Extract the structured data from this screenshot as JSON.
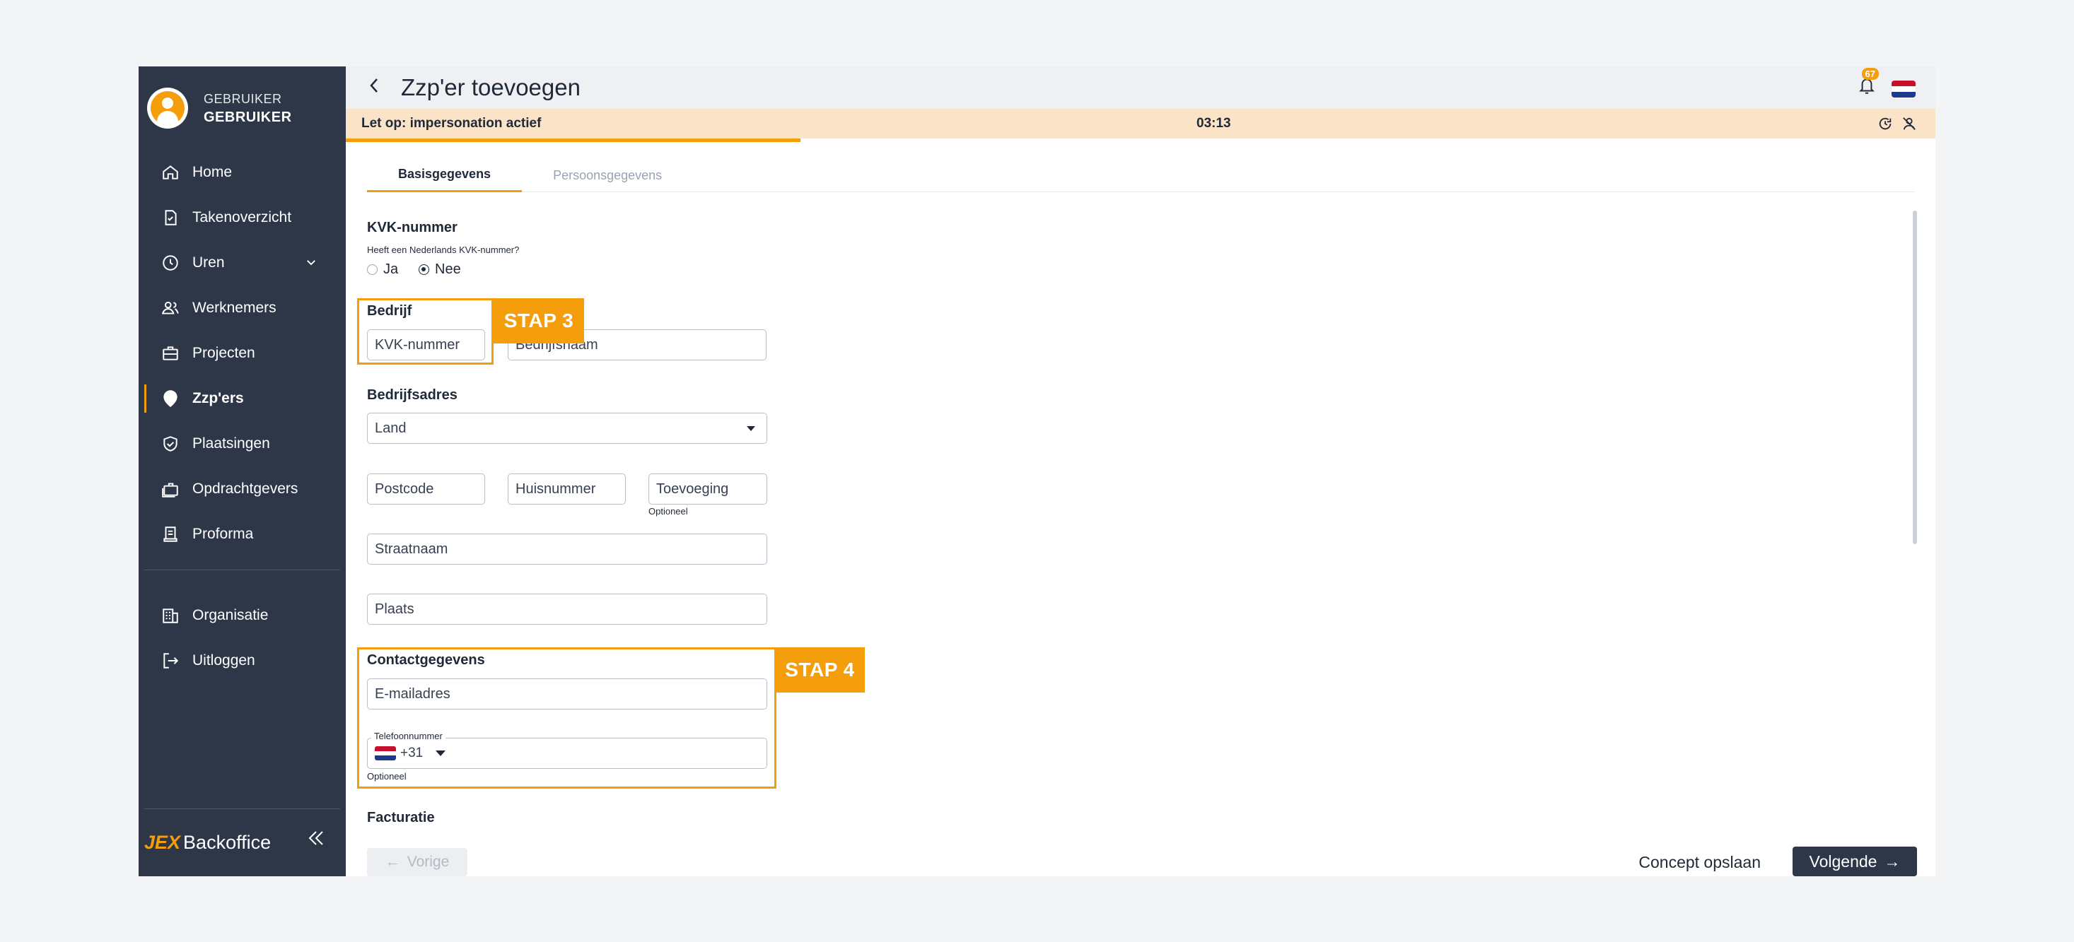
{
  "user": {
    "role": "GEBRUIKER",
    "name": "GEBRUIKER"
  },
  "nav": {
    "items": [
      {
        "label": "Home",
        "icon": "home-icon"
      },
      {
        "label": "Takenoverzicht",
        "icon": "task-icon"
      },
      {
        "label": "Uren",
        "icon": "clock-icon"
      },
      {
        "label": "Werknemers",
        "icon": "people-icon"
      },
      {
        "label": "Projecten",
        "icon": "briefcase-icon"
      },
      {
        "label": "Zzp'ers",
        "icon": "person-pin-icon"
      },
      {
        "label": "Plaatsingen",
        "icon": "shield-check-icon"
      },
      {
        "label": "Opdrachtgevers",
        "icon": "client-icon"
      },
      {
        "label": "Proforma",
        "icon": "document-icon"
      }
    ],
    "bottom": [
      {
        "label": "Organisatie",
        "icon": "building-icon"
      },
      {
        "label": "Uitloggen",
        "icon": "logout-icon"
      }
    ]
  },
  "brand": {
    "jex": "JEX",
    "name": "Backoffice"
  },
  "header": {
    "title": "Zzp'er toevoegen",
    "notifications": "67"
  },
  "impersonation": {
    "label": "Let op: impersonation actief",
    "timer": "03:13",
    "progress": 0.286
  },
  "tabs": [
    {
      "label": "Basisgegevens"
    },
    {
      "label": "Persoonsgegevens"
    }
  ],
  "form": {
    "kvk": {
      "heading": "KVK-nummer",
      "question": "Heeft een Nederlands KVK-nummer?",
      "options": [
        "Ja",
        "Nee"
      ],
      "selected": "Nee"
    },
    "bedrijf": {
      "heading": "Bedrijf",
      "kvk_placeholder": "KVK-nummer",
      "name_placeholder": "Bedrijfsnaam"
    },
    "adres": {
      "heading": "Bedrijfsadres",
      "land": "Land",
      "postcode": "Postcode",
      "huisnummer": "Huisnummer",
      "toevoeging": "Toevoeging",
      "optioneel": "Optioneel",
      "straatnaam": "Straatnaam",
      "plaats": "Plaats"
    },
    "contact": {
      "heading": "Contactgegevens",
      "email": "E-mailadres",
      "phone_label": "Telefoonnummer",
      "phone_prefix": "+31",
      "optioneel": "Optioneel"
    },
    "facturatie": {
      "heading": "Facturatie"
    }
  },
  "steps": {
    "stap3": "STAP 3",
    "stap4": "STAP 4"
  },
  "footer": {
    "prev": "Vorige",
    "concept": "Concept opslaan",
    "next": "Volgende"
  },
  "colors": {
    "accent": "#f59e0b",
    "sidebar": "#2d3748",
    "banner": "#fbe3c8"
  }
}
